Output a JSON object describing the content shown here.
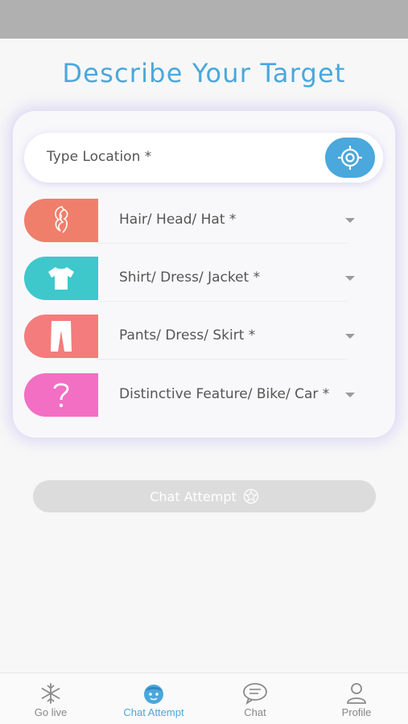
{
  "title": "Describe Your Target",
  "location": {
    "label": "Type Location *"
  },
  "rows": [
    {
      "label": "Hair/ Head/ Hat *",
      "color": "#ef7f6b"
    },
    {
      "label": "Shirt/ Dress/ Jacket *",
      "color": "#3ec8cc"
    },
    {
      "label": "Pants/ Dress/ Skirt *",
      "color": "#f47c7c"
    },
    {
      "label": "Distinctive Feature/ Bike/ Car *",
      "color": "#f26fc4"
    }
  ],
  "chat_button": {
    "label": "Chat Attempt"
  },
  "nav": [
    {
      "label": "Go live",
      "icon": "snowflake-icon"
    },
    {
      "label": "Chat Attempt",
      "icon": "face-icon"
    },
    {
      "label": "Chat",
      "icon": "chat-bubble-icon"
    },
    {
      "label": "Profile",
      "icon": "person-icon"
    }
  ],
  "colors": {
    "accent": "#4aa8dc",
    "nav_inactive": "#888888"
  }
}
